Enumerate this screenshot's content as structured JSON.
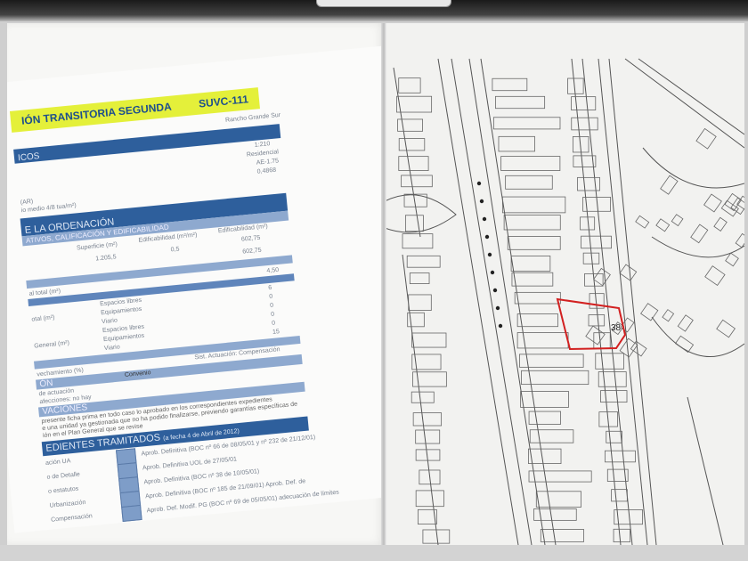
{
  "document": {
    "title": "IÓN TRANSITORIA SEGUNDA",
    "code": "SUVC-111",
    "section_general": "ICOS",
    "general_values": [
      "Rancho Grande Sur",
      "1:210",
      "Residencial",
      "AE-1.75",
      "0,4868"
    ],
    "general_labels": [
      "(AR)",
      "io medio 4/8 tua/m²)"
    ],
    "section_ordenacion": "E LA ORDENACIÓN",
    "subsection_ordenacion": "ATIVOS, CALIFICACIÓN Y EDIFICABILIDAD",
    "table_headers": [
      "Superficie (m²)",
      "Edificabilidad (m²/m²)",
      "Edificabilidad (m²)"
    ],
    "table_row": [
      "1.205,5",
      "0,5",
      "602,75"
    ],
    "table_total": "602,75",
    "rows": [
      {
        "label": "al total (m²)",
        "sub": "",
        "value": "4,50"
      },
      {
        "label": "",
        "sub": "Espacios libres",
        "value": "6"
      },
      {
        "label": "otal (m²)",
        "sub": "Equipamientos",
        "value": "0"
      },
      {
        "label": "",
        "sub": "Viario",
        "value": "0"
      },
      {
        "label": "",
        "sub": "Espacios libres",
        "value": "0"
      },
      {
        "label": "General (m²)",
        "sub": "Equipamientos",
        "value": "0"
      },
      {
        "label": "",
        "sub": "Viario",
        "value": "15"
      }
    ],
    "aprovechamiento": "vechamiento (%)",
    "gestion_label": "ÓN",
    "gestion_values": [
      "de actuación",
      "Compensación",
      "Sist. Actuación: Compensación"
    ],
    "sistema": "Convenio",
    "afecciones": "afecciones: no hay",
    "observaciones_title": "VACIONES",
    "observaciones_text": [
      "presente ficha prima en todo caso lo aprobado en los correspondientes expedientes",
      "e una unidad ya gestionada que no ha podido finalizarse, previendo garantías específicas de",
      "ión en el Plan General que se revise"
    ],
    "expedientes_title": "EDIENTES TRAMITADOS",
    "expedientes_date": "(a fecha 4 de Abril de 2012)",
    "expedientes": [
      {
        "label": "ación UA",
        "value": "Aprob. Definitiva (BOC nº 66 de 08/05/01 y nº 232 de 21/12/01)"
      },
      {
        "label": "o de Detalle",
        "value": "Aprob. Definitiva UOL de 27/05/01"
      },
      {
        "label": "o estatutos",
        "value": "Aprob. Definitiva (BOC nº 38 de 10/05/01)"
      },
      {
        "label": "Urbanización",
        "value": "Aprob. Definitiva (BOC nº 185 de 21/09/01)  Aprob. Def. de"
      },
      {
        "label": "Compensación",
        "value": "Aprob. Def. Modif. PG (BOC nº 69 de 05/05/01) adecuación de límites"
      }
    ]
  },
  "map": {
    "parcel_number": "38",
    "highlight_color": "#d22020"
  }
}
